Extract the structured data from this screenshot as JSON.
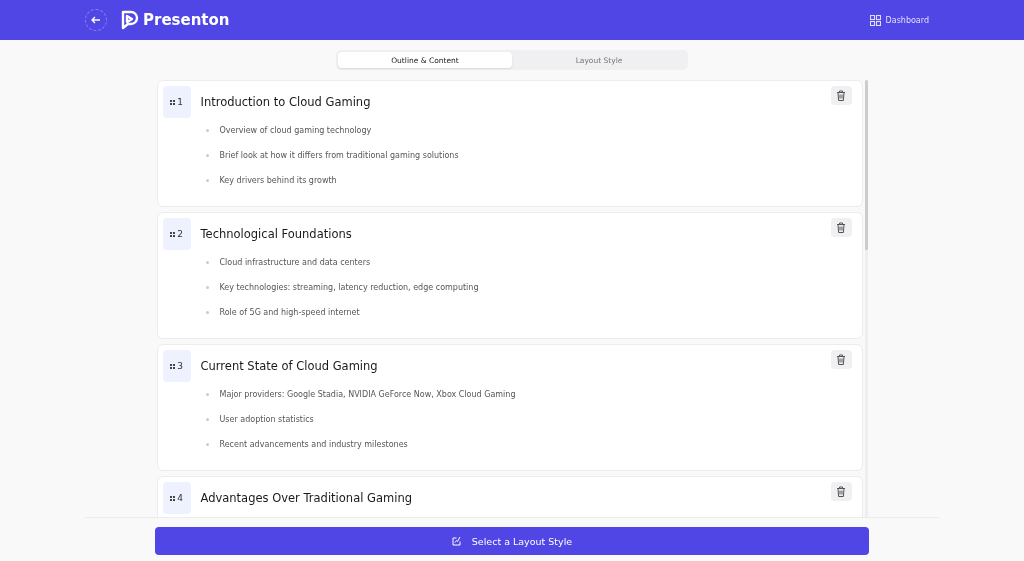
{
  "header": {
    "brand": "Presenton",
    "dashboard_link": "Dashboard"
  },
  "tabs": [
    {
      "label": "Outline & Content",
      "selected": true
    },
    {
      "label": "Layout Style",
      "selected": false
    }
  ],
  "slides": [
    {
      "number": "1",
      "title": "Introduction to Cloud Gaming",
      "bullets": [
        "Overview of cloud gaming technology",
        "Brief look at how it differs from traditional gaming solutions",
        "Key drivers behind its growth"
      ]
    },
    {
      "number": "2",
      "title": "Technological Foundations",
      "bullets": [
        "Cloud infrastructure and data centers",
        "Key technologies: streaming, latency reduction, edge computing",
        "Role of 5G and high-speed internet"
      ]
    },
    {
      "number": "3",
      "title": "Current State of Cloud Gaming",
      "bullets": [
        "Major providers: Google Stadia, NVIDIA GeForce Now, Xbox Cloud Gaming",
        "User adoption statistics",
        "Recent advancements and industry milestones"
      ]
    },
    {
      "number": "4",
      "title": "Advantages Over Traditional Gaming"
    }
  ],
  "footer": {
    "button": "Select a Layout Style"
  }
}
